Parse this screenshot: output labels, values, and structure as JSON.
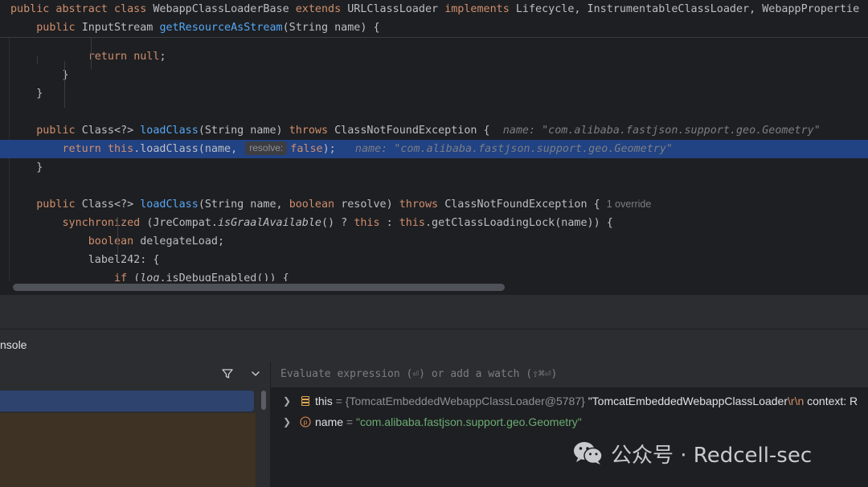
{
  "editor": {
    "sticky_lines": [
      {
        "indent": "",
        "parts": [
          {
            "t": "public abstract class ",
            "c": "kw"
          },
          {
            "t": "WebappClassLoaderBase ",
            "c": "ty"
          },
          {
            "t": "extends ",
            "c": "kw"
          },
          {
            "t": "URLClassLoader ",
            "c": "ty"
          },
          {
            "t": "implements ",
            "c": "kw"
          },
          {
            "t": "Lifecycle, InstrumentableClassLoader, WebappPropertie",
            "c": "ty"
          }
        ]
      },
      {
        "indent": "    ",
        "parts": [
          {
            "t": "public ",
            "c": "kw"
          },
          {
            "t": "InputStream ",
            "c": "ty"
          },
          {
            "t": "getResourceAsStream",
            "c": "fn"
          },
          {
            "t": "(String name) {",
            "c": "ty"
          }
        ]
      }
    ],
    "lines": [
      {
        "indent": "            ",
        "parts": [
          {
            "t": "return ",
            "c": "kw"
          },
          {
            "t": "null",
            "c": "kw"
          },
          {
            "t": ";",
            "c": "ty"
          }
        ]
      },
      {
        "indent": "        ",
        "parts": [
          {
            "t": "}",
            "c": "ty"
          }
        ]
      },
      {
        "indent": "    ",
        "parts": [
          {
            "t": "}",
            "c": "ty"
          }
        ]
      },
      {
        "indent": "",
        "parts": []
      },
      {
        "indent": "    ",
        "parts": [
          {
            "t": "public ",
            "c": "kw"
          },
          {
            "t": "Class<?> ",
            "c": "ty"
          },
          {
            "t": "loadClass",
            "c": "fn"
          },
          {
            "t": "(String name) ",
            "c": "ty"
          },
          {
            "t": "throws ",
            "c": "kw"
          },
          {
            "t": "ClassNotFoundException {  ",
            "c": "ty"
          },
          {
            "t": "name: \"com.alibaba.fastjson.support.geo.Geometry\"",
            "c": "ghost"
          }
        ]
      },
      {
        "indent": "        ",
        "highlight": true,
        "parts": [
          {
            "t": "return ",
            "c": "kw"
          },
          {
            "t": "this",
            "c": "kw"
          },
          {
            "t": ".loadClass(name, ",
            "c": "ty"
          },
          {
            "t": "resolve:",
            "c": "hint-inline"
          },
          {
            "t": "false",
            "c": "kw"
          },
          {
            "t": ");   ",
            "c": "ty"
          },
          {
            "t": "name: \"com.alibaba.fastjson.support.geo.Geometry\"",
            "c": "ghost"
          }
        ]
      },
      {
        "indent": "    ",
        "parts": [
          {
            "t": "}",
            "c": "ty"
          }
        ]
      },
      {
        "indent": "",
        "parts": []
      },
      {
        "indent": "    ",
        "parts": [
          {
            "t": "public ",
            "c": "kw"
          },
          {
            "t": "Class<?> ",
            "c": "ty"
          },
          {
            "t": "loadClass",
            "c": "fn"
          },
          {
            "t": "(String name, ",
            "c": "ty"
          },
          {
            "t": "boolean ",
            "c": "kw"
          },
          {
            "t": "resolve) ",
            "c": "ty"
          },
          {
            "t": "throws ",
            "c": "kw"
          },
          {
            "t": "ClassNotFoundException { ",
            "c": "ty"
          },
          {
            "t": "1 override",
            "c": "override"
          }
        ]
      },
      {
        "indent": "        ",
        "parts": [
          {
            "t": "synchronized ",
            "c": "kw"
          },
          {
            "t": "(JreCompat.",
            "c": "ty"
          },
          {
            "t": "isGraalAvailable",
            "c": "it"
          },
          {
            "t": "() ? ",
            "c": "ty"
          },
          {
            "t": "this",
            "c": "kw"
          },
          {
            "t": " : ",
            "c": "ty"
          },
          {
            "t": "this",
            "c": "kw"
          },
          {
            "t": ".getClassLoadingLock(name)) {",
            "c": "ty"
          }
        ]
      },
      {
        "indent": "            ",
        "parts": [
          {
            "t": "boolean ",
            "c": "kw"
          },
          {
            "t": "delegateLoad;",
            "c": "ty"
          }
        ]
      },
      {
        "indent": "            ",
        "parts": [
          {
            "t": "label242: {",
            "c": "ty"
          }
        ]
      },
      {
        "indent": "                ",
        "parts": [
          {
            "t": "if ",
            "c": "kw"
          },
          {
            "t": "(",
            "c": "ty"
          },
          {
            "t": "log",
            "c": "it"
          },
          {
            "t": ".isDebugEnabled()) {",
            "c": "ty"
          }
        ]
      }
    ]
  },
  "debug": {
    "tab_label": "nsole",
    "filter_icon": "filter-icon",
    "expand_icon": "chevron-down-icon",
    "eval_placeholder": "Evaluate expression (⏎) or add a watch (⇧⌘⏎)",
    "variables": [
      {
        "icon": "field-stack-icon",
        "name": "this",
        "parts": [
          {
            "t": " = ",
            "c": "vdim"
          },
          {
            "t": "{TomcatEmbeddedWebappClassLoader@5787} ",
            "c": "vdim"
          },
          {
            "t": "\"TomcatEmbeddedWebappClassLoader",
            "c": "vname"
          },
          {
            "t": "\\r\\n",
            "c": "vesc"
          },
          {
            "t": "  context: R",
            "c": "vname"
          }
        ]
      },
      {
        "icon": "parameter-icon",
        "name": "name",
        "parts": [
          {
            "t": " = ",
            "c": "vdim"
          },
          {
            "t": "\"com.alibaba.fastjson.support.geo.Geometry\"",
            "c": "vstr"
          }
        ]
      }
    ]
  },
  "watermark": {
    "text": "公众号 · Redcell-sec",
    "icon": "wechat-logo"
  },
  "colors": {
    "keyword": "#cf8e6d",
    "function": "#56a8f5",
    "string": "#6aab73",
    "highlight_line": "#214283",
    "editor_bg": "#1e1f22",
    "panel_bg": "#2b2d30"
  }
}
